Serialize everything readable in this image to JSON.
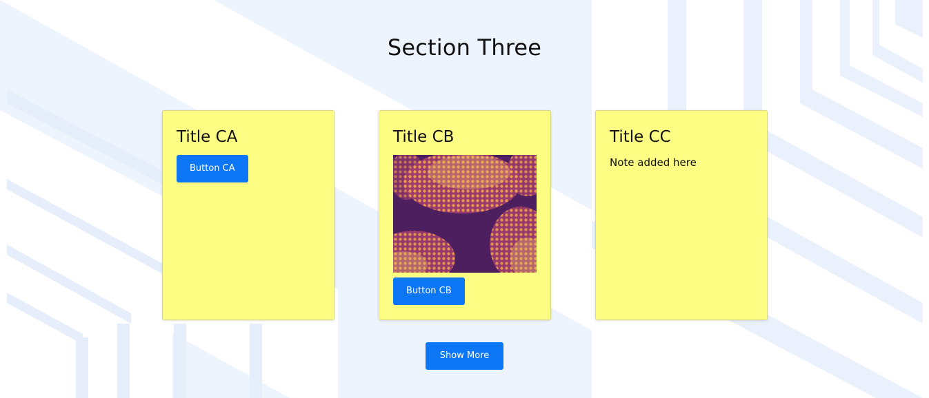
{
  "section": {
    "title": "Section Three"
  },
  "cards": [
    {
      "title": "Title CA",
      "button_label": "Button CA"
    },
    {
      "title": "Title CB",
      "image": "abstract purple and orange dotted waves",
      "button_label": "Button CB"
    },
    {
      "title": "Title CC",
      "note": "Note added here"
    }
  ],
  "show_more_label": "Show More",
  "colors": {
    "card_background": "#fdfd84",
    "button": "#0d76f5",
    "page_background": "#eef4fd",
    "image_purple": "#4e1f5e",
    "image_orange": "#f0a24a"
  }
}
